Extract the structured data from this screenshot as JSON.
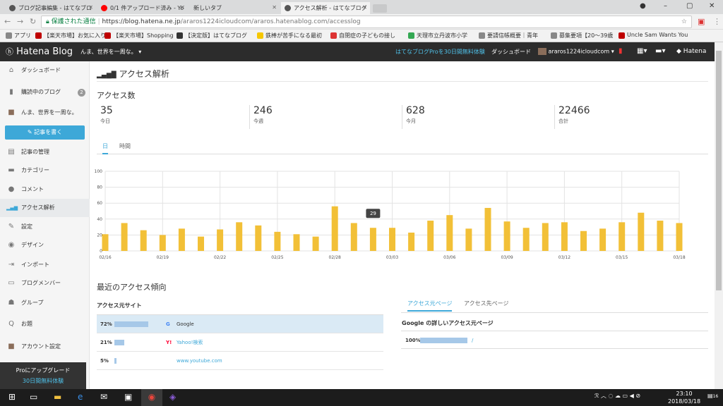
{
  "browser": {
    "tabs": [
      {
        "title": "ブログ記事編集 - はてなブロ",
        "color": "#555"
      },
      {
        "title": "0/1 件アップロード済み - Yo",
        "color": "#ff0000"
      },
      {
        "title": "新しいタブ",
        "color": ""
      },
      {
        "title": "アクセス解析 - はてなブログ",
        "color": "#555"
      }
    ],
    "secure_label": "保護された通信",
    "url_host": "https://blog.hatena.ne.jp",
    "url_path": "/araros1224icloudcom/araros.hatenablog.com/accesslog",
    "bookmarks": [
      {
        "label": "アプリ",
        "color": "#888"
      },
      {
        "label": "【楽天市場】お気に入り",
        "color": "#bf0000"
      },
      {
        "label": "【楽天市場】Shopping",
        "color": "#bf0000"
      },
      {
        "label": "【決定版】はてなブログ",
        "color": "#333"
      },
      {
        "label": "鉄棒が苦手になる最初",
        "color": "#f6c700"
      },
      {
        "label": "自閉症の子どもの接し",
        "color": "#d33"
      },
      {
        "label": "天理市立丹波市小学",
        "color": "#34a853"
      },
      {
        "label": "要請信帳概要｜青年",
        "color": "#888"
      },
      {
        "label": "募集要項【20～39歳",
        "color": "#888"
      },
      {
        "label": "Uncle Sam Wants You",
        "color": "#bf0000"
      }
    ]
  },
  "header": {
    "logo": "Hatena Blog",
    "blog_name": "んま、世界を一周な。",
    "pro_link": "はてなブログProを30日間無料体験",
    "dashboard": "ダッシュボード",
    "user": "araros1224icloudcom",
    "brand": "Hatena"
  },
  "sidebar": {
    "items": [
      {
        "label": "ダッシュボード",
        "icon": "home-icon",
        "glyph": "⌂"
      },
      {
        "label": "購読中のブログ",
        "icon": "bookmark-icon",
        "glyph": "▮",
        "badge": "2"
      },
      {
        "label": "んま、世界を一周な。",
        "icon": "avatar",
        "glyph": "■"
      },
      {
        "label": "記事の管理",
        "icon": "document-icon",
        "glyph": "▤"
      },
      {
        "label": "カテゴリー",
        "icon": "folder-icon",
        "glyph": "▬"
      },
      {
        "label": "コメント",
        "icon": "comment-icon",
        "glyph": "●"
      },
      {
        "label": "アクセス解析",
        "icon": "bar-chart-icon",
        "glyph": "▂▄▆"
      },
      {
        "label": "設定",
        "icon": "wrench-icon",
        "glyph": "✎"
      },
      {
        "label": "デザイン",
        "icon": "palette-icon",
        "glyph": "◉"
      },
      {
        "label": "インポート",
        "icon": "import-icon",
        "glyph": "⇥"
      },
      {
        "label": "ブログメンバー",
        "icon": "members-icon",
        "glyph": "▭"
      },
      {
        "label": "グループ",
        "icon": "group-icon",
        "glyph": "☗"
      },
      {
        "label": "お題",
        "icon": "question-icon",
        "glyph": "Q"
      },
      {
        "label": "アカウント設定",
        "icon": "avatar",
        "glyph": "■"
      }
    ],
    "write_button": "記事を書く",
    "pro_title": "Proにアップグレード",
    "pro_sub": "30日間無料体験"
  },
  "main": {
    "title": "アクセス解析",
    "access_count_heading": "アクセス数",
    "stats": [
      {
        "value": "35",
        "label": "今日"
      },
      {
        "value": "246",
        "label": "今週"
      },
      {
        "value": "628",
        "label": "今月"
      },
      {
        "value": "22466",
        "label": "合計"
      }
    ],
    "subtabs": [
      "日",
      "時間"
    ],
    "trend_heading": "最近のアクセス傾向",
    "referrer_heading": "アクセス元サイト",
    "referrers": [
      {
        "pct": "72%",
        "pct_value": 72,
        "source": "Google"
      },
      {
        "pct": "21%",
        "pct_value": 21,
        "source": "Yahoo!検索"
      },
      {
        "pct": "5%",
        "pct_value": 5,
        "source": "www.youtube.com"
      }
    ],
    "right_tabs": [
      "アクセス元ページ",
      "アクセス先ページ"
    ],
    "google_detail_heading": "Google の詳しいアクセス元ページ",
    "google_detail": [
      {
        "pct": "100%",
        "pct_value": 100,
        "path": "/"
      }
    ]
  },
  "chart_data": {
    "type": "bar",
    "categories": [
      "02/16",
      "02/17",
      "02/18",
      "02/19",
      "02/20",
      "02/21",
      "02/22",
      "02/23",
      "02/24",
      "02/25",
      "02/26",
      "02/27",
      "02/28",
      "03/01",
      "03/02",
      "03/03",
      "03/04",
      "03/05",
      "03/06",
      "03/07",
      "03/08",
      "03/09",
      "03/10",
      "03/11",
      "03/12",
      "03/13",
      "03/14",
      "03/15",
      "03/16",
      "03/17",
      "03/18"
    ],
    "tick_labels": [
      "02/16",
      "02/19",
      "02/22",
      "02/25",
      "02/28",
      "03/03",
      "03/06",
      "03/09",
      "03/12",
      "03/15",
      "03/18"
    ],
    "values": [
      21,
      35,
      26,
      20,
      28,
      18,
      27,
      36,
      32,
      24,
      21,
      18,
      56,
      35,
      29,
      29,
      23,
      38,
      45,
      28,
      54,
      37,
      29,
      35,
      36,
      25,
      28,
      36,
      48,
      38,
      35
    ],
    "ylim": [
      0,
      100
    ],
    "yticks": [
      0,
      20,
      40,
      60,
      80,
      100
    ],
    "tooltip": "29",
    "bar_color": "#f2c037",
    "grid": true
  },
  "taskbar": {
    "time": "23:10",
    "date": "2018/03/18",
    "notif": "16"
  }
}
